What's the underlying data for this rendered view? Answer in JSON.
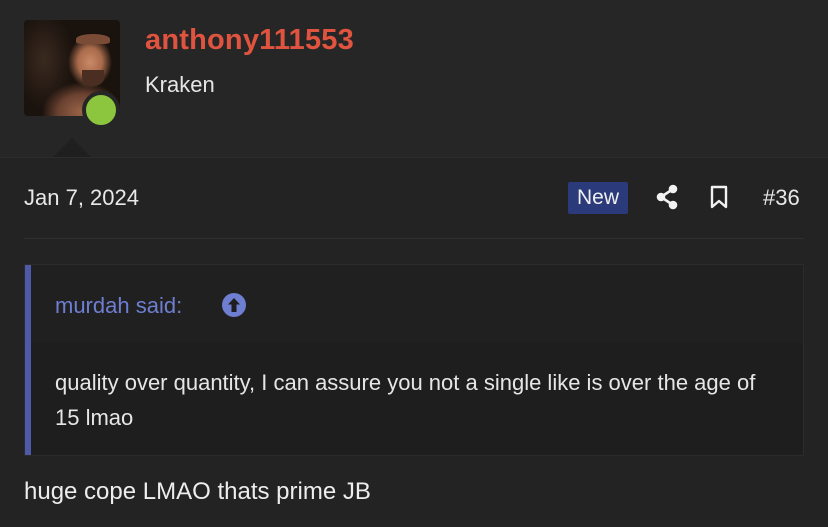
{
  "user": {
    "username": "anthony111553",
    "title": "Kraken",
    "username_color": "#e0543f",
    "online_color": "#8cc63f"
  },
  "post": {
    "date": "Jan 7, 2024",
    "badge": "New",
    "number": "#36",
    "icons": [
      "share-icon",
      "bookmark-icon"
    ]
  },
  "quote": {
    "author": "murdah said:",
    "text": "quality over quantity, I can assure you not a single like is over the age of 15 lmao",
    "accent_color": "#4e5aa8"
  },
  "reply": {
    "text": "huge cope LMAO thats prime JB"
  }
}
